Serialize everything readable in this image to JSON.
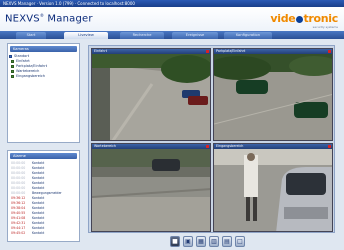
{
  "window": {
    "title": "NEXVS Manager  ·  Version 1.0 (799)  ·  Connected to localhost:8000"
  },
  "header": {
    "app_name": "NEXVS",
    "app_name_suffix": " Manager",
    "trademark": "®",
    "brand_before": "vide",
    "brand_after": "tronic",
    "brand_sub": "security systems"
  },
  "tabs": [
    "Start",
    "Liveview",
    "Recherche",
    "Ereignisse",
    "Konfiguration"
  ],
  "tree_panel": {
    "title": "Kameras",
    "items": [
      {
        "label": "Standort",
        "root": true
      },
      {
        "label": "Einfahrt"
      },
      {
        "label": "Parkplatz/Einfahrt"
      },
      {
        "label": "Wartebereich"
      },
      {
        "label": "Eingangsbereich"
      }
    ]
  },
  "events_panel": {
    "title": "Alarme",
    "rows": [
      {
        "time": "00:00:00",
        "text": "Kontakt",
        "dim": true
      },
      {
        "time": "00:00:00",
        "text": "Kontakt",
        "dim": true
      },
      {
        "time": "00:00:00",
        "text": "Kontakt",
        "dim": true
      },
      {
        "time": "00:00:00",
        "text": "Kontakt",
        "dim": true
      },
      {
        "time": "00:00:00",
        "text": "Kontakt",
        "dim": true
      },
      {
        "time": "00:00:00",
        "text": "Kontakt",
        "dim": true
      },
      {
        "time": "00:00:00",
        "text": "Bewegungsmelder",
        "dim": true
      },
      {
        "time": "09:36:12",
        "text": "Kontakt",
        "dim": false
      },
      {
        "time": "09:36:12",
        "text": "Kontakt",
        "dim": false
      },
      {
        "time": "09:38:04",
        "text": "Kontakt",
        "dim": false
      },
      {
        "time": "09:40:55",
        "text": "Kontakt",
        "dim": false
      },
      {
        "time": "09:41:08",
        "text": "Kontakt",
        "dim": false
      },
      {
        "time": "09:42:31",
        "text": "Kontakt",
        "dim": false
      },
      {
        "time": "09:44:17",
        "text": "Kontakt",
        "dim": false
      },
      {
        "time": "09:45:02",
        "text": "Kontakt",
        "dim": false
      }
    ]
  },
  "cameras": [
    {
      "title": "Einfahrt"
    },
    {
      "title": "Parkplatz/Einfahrt"
    },
    {
      "title": "Wartebereich"
    },
    {
      "title": "Eingangsbereich"
    }
  ],
  "controls": [
    {
      "icon": "record-icon",
      "glyph": "■",
      "style": "dark"
    },
    {
      "icon": "layout-1x1-icon",
      "glyph": "▣",
      "style": "light"
    },
    {
      "icon": "layout-2x2-icon",
      "glyph": "▦",
      "style": "light"
    },
    {
      "icon": "layout-3x3-icon",
      "glyph": "▥",
      "style": "light"
    },
    {
      "icon": "layout-4x4-icon",
      "glyph": "▤",
      "style": "light"
    },
    {
      "icon": "fullscreen-icon",
      "glyph": "□",
      "style": "light"
    }
  ]
}
